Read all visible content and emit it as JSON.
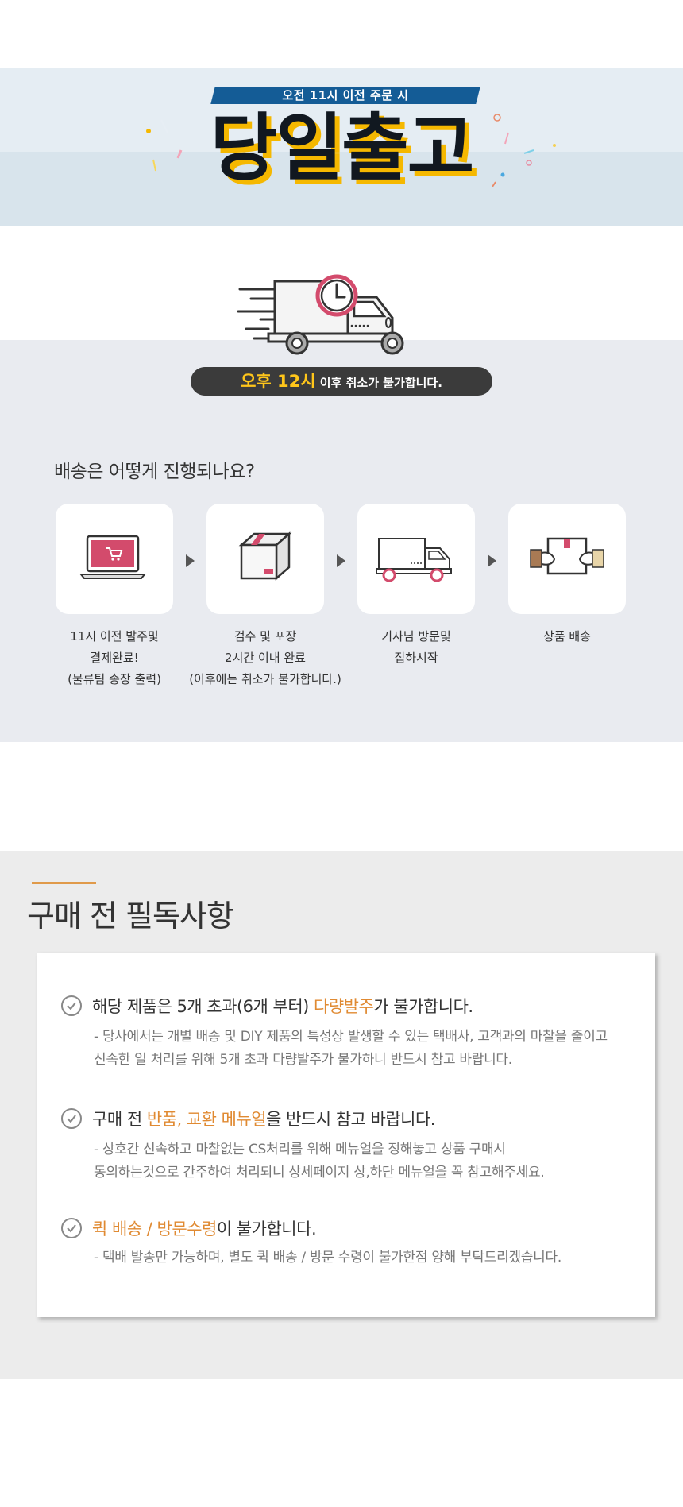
{
  "colors": {
    "banner_bg": "#e5edf3",
    "ribbon": "#145c96",
    "title_yellow": "#f5b800",
    "accent_orange": "#e08a32",
    "pill_bg": "#3b3b3b",
    "pill_highlight": "#ffc61a",
    "card_pink": "#d34b6c"
  },
  "banner": {
    "ribbon_text": "오전 11시 이전 주문 시",
    "title": "당일출고"
  },
  "cancel_notice": {
    "highlight": "오후 12시",
    "text": " 이후 취소가 불가합니다."
  },
  "process": {
    "question": "배송은 어떻게 진행되나요?",
    "steps": [
      {
        "icon": "laptop-cart-icon",
        "caption": "11시 이전 발주및\n결제완료!\n(물류팀 송장 출력)"
      },
      {
        "icon": "package-box-icon",
        "caption": "검수 및 포장\n2시간 이내 완료\n(이후에는 취소가 불가합니다.)"
      },
      {
        "icon": "delivery-truck-icon",
        "caption": "기사님 방문및\n집하시작"
      },
      {
        "icon": "hand-over-box-icon",
        "caption": "상품 배송"
      }
    ]
  },
  "notice": {
    "title": "구매 전 필독사항",
    "items": [
      {
        "title_pre": "해당 제품은 5개 초과(6개 부터) ",
        "title_hl": "다량발주",
        "title_post": "가 불가합니다.",
        "desc": "- 당사에서는 개별 배송 및 DIY 제품의 특성상 발생할 수 있는 택배사, 고객과의 마찰을 줄이고\n  신속한 일 처리를 위해 5개 초과 다량발주가 불가하니 반드시 참고 바랍니다."
      },
      {
        "title_pre": "구매 전 ",
        "title_hl": "반품, 교환 메뉴얼",
        "title_post": "을 반드시 참고 바랍니다.",
        "desc": "- 상호간 신속하고 마찰없는 CS처리를 위해 메뉴얼을 정해놓고 상품 구매시\n  동의하는것으로 간주하여 처리되니 상세페이지 상,하단 메뉴얼을 꼭 참고해주세요."
      },
      {
        "title_pre": "",
        "title_hl": "퀵 배송 / 방문수령",
        "title_post": "이 불가합니다.",
        "desc": "- 택배 발송만 가능하며, 별도 퀵 배송 / 방문 수령이 불가한점 양해 부탁드리겠습니다."
      }
    ]
  }
}
